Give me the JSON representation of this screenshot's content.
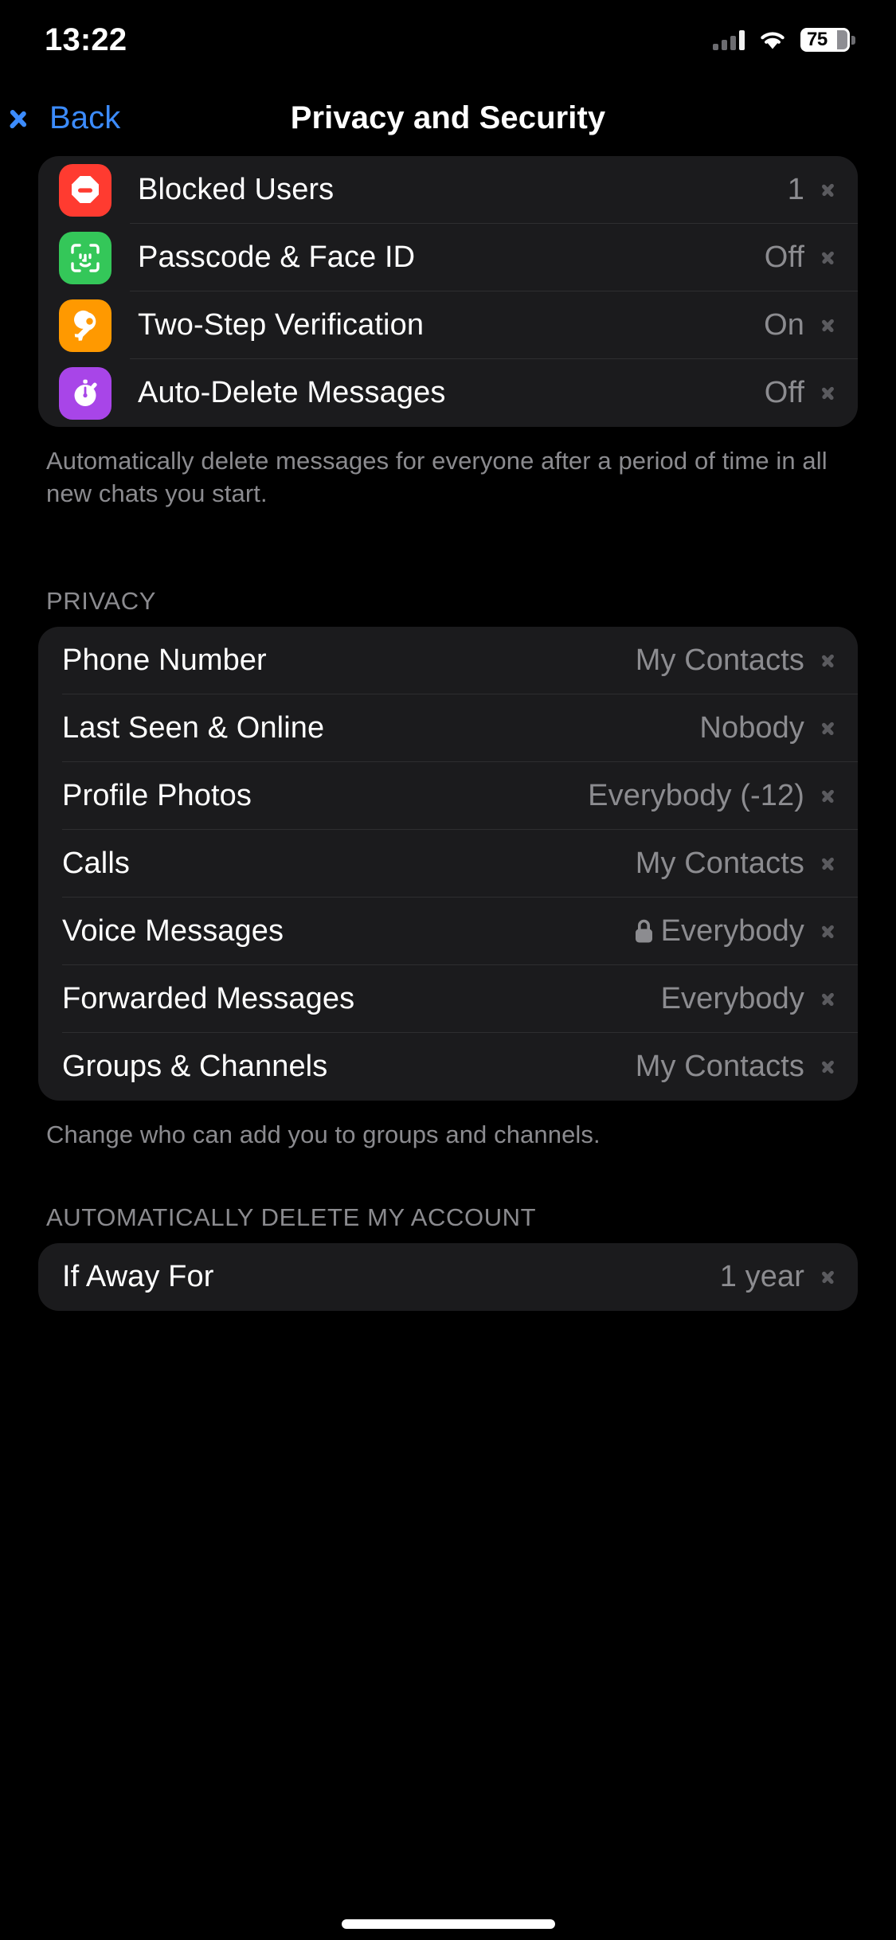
{
  "status_bar": {
    "time": "13:22",
    "battery_percent": "75",
    "signal_icon": "cellular-bars-icon",
    "wifi_icon": "wifi-icon",
    "battery_icon": "battery-icon"
  },
  "nav": {
    "back_label": "Back",
    "back_icon": "chevron-left-icon",
    "title": "Privacy and Security",
    "accent_color": "#3c8cff"
  },
  "security_section": {
    "rows": [
      {
        "label": "Blocked Users",
        "value": "1",
        "icon": "block-user-icon",
        "icon_color": "#ff3b30"
      },
      {
        "label": "Passcode & Face ID",
        "value": "Off",
        "icon": "face-id-icon",
        "icon_color": "#34c759"
      },
      {
        "label": "Two-Step Verification",
        "value": "On",
        "icon": "key-icon",
        "icon_color": "#f90"
      },
      {
        "label": "Auto-Delete Messages",
        "value": "Off",
        "icon": "stopwatch-icon",
        "icon_color": "#a845e8"
      }
    ],
    "footnote": "Automatically delete messages for everyone after a period of time in all new chats you start."
  },
  "privacy_section": {
    "header": "PRIVACY",
    "rows": [
      {
        "label": "Phone Number",
        "value": "My Contacts",
        "locked": false
      },
      {
        "label": "Last Seen & Online",
        "value": "Nobody",
        "locked": false
      },
      {
        "label": "Profile Photos",
        "value": "Everybody (-12)",
        "locked": false
      },
      {
        "label": "Calls",
        "value": "My Contacts",
        "locked": false
      },
      {
        "label": "Voice Messages",
        "value": "Everybody",
        "locked": true
      },
      {
        "label": "Forwarded Messages",
        "value": "Everybody",
        "locked": false
      },
      {
        "label": "Groups & Channels",
        "value": "My Contacts",
        "locked": false
      }
    ],
    "footnote": "Change who can add you to groups and channels."
  },
  "delete_account_section": {
    "header": "AUTOMATICALLY DELETE MY ACCOUNT",
    "rows": [
      {
        "label": "If Away For",
        "value": "1 year"
      }
    ]
  },
  "home_indicator": "home-indicator"
}
